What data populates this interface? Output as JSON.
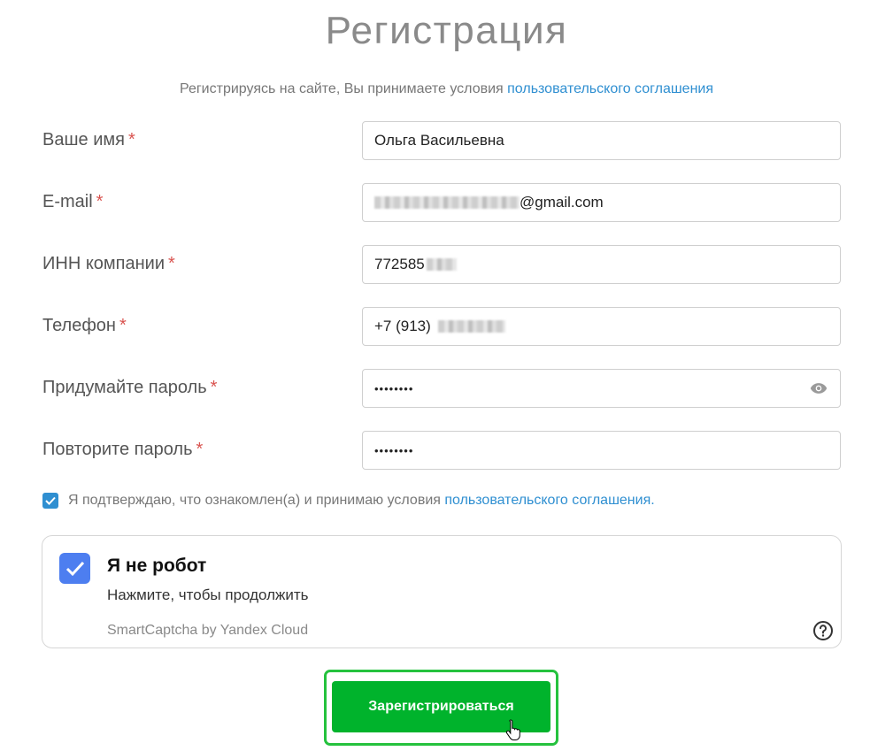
{
  "page": {
    "title": "Регистрация",
    "agreement_prefix": "Регистрируясь на сайте, Вы принимаете условия ",
    "agreement_link": "пользовательского соглашения"
  },
  "form": {
    "required_mark": "*",
    "fields": [
      {
        "label": "Ваше имя",
        "value": "Ольга Васильевна"
      },
      {
        "label": "E-mail",
        "value_suffix": "@gmail.com"
      },
      {
        "label": "ИНН компании",
        "value_prefix": "772585"
      },
      {
        "label": "Телефон",
        "value_prefix": "+7 (913)"
      },
      {
        "label": "Придумайте пароль",
        "value": "••••••••"
      },
      {
        "label": "Повторите пароль",
        "value": "••••••••"
      }
    ],
    "consent_text": "Я подтверждаю, что ознакомлен(а) и принимаю условия ",
    "consent_link": "пользовательского соглашения."
  },
  "captcha": {
    "title": "Я не робот",
    "subtitle": "Нажмите, чтобы продолжить",
    "brand": "SmartCaptcha by Yandex Cloud",
    "help_icon": "question-icon"
  },
  "submit": {
    "label": "Зарегистрироваться"
  },
  "colors": {
    "accent_link": "#2f8fd1",
    "button_green": "#00b32c",
    "captcha_check": "#4d7ef0",
    "required": "#d9534f"
  }
}
